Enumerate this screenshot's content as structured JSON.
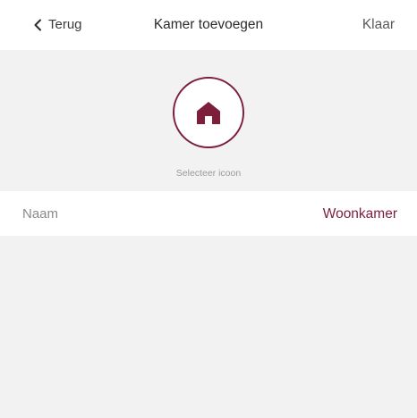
{
  "nav": {
    "back_label": "Terug",
    "title": "Kamer toevoegen",
    "done_label": "Klaar"
  },
  "icon_picker": {
    "icon": "home-icon",
    "label": "Selecteer icoon"
  },
  "name_row": {
    "label": "Naam",
    "value": "Woonkamer"
  },
  "colors": {
    "accent": "#7d1f3a",
    "background": "#f2f2f2",
    "surface": "#ffffff"
  }
}
